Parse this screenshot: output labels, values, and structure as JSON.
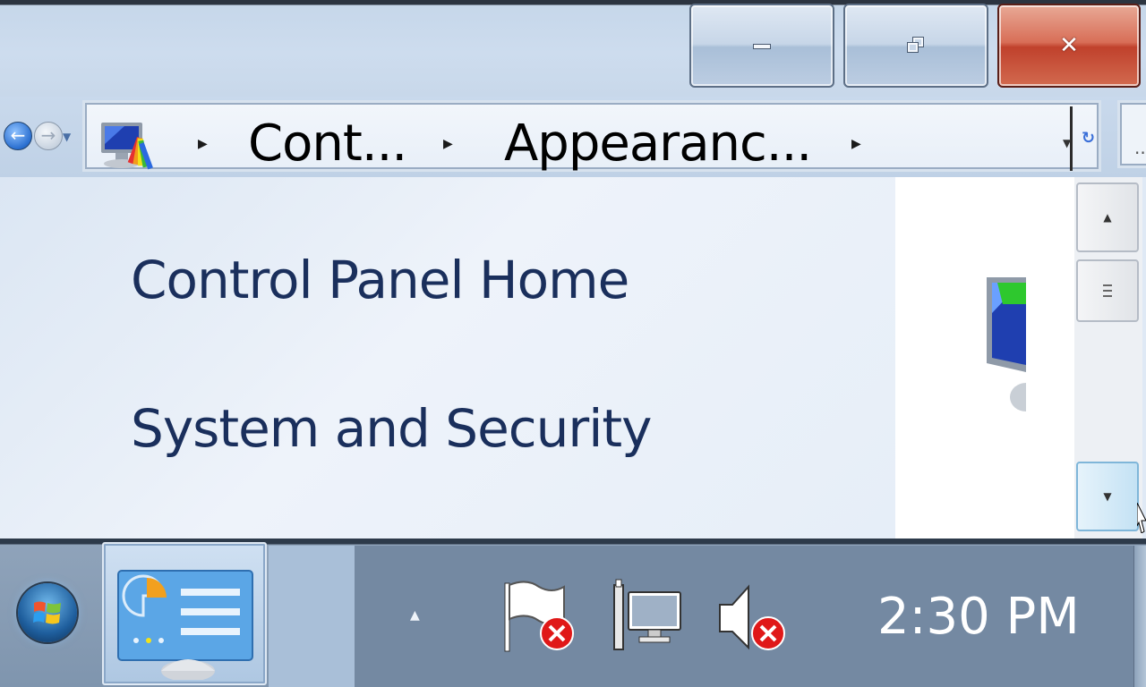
{
  "window": {
    "buttons": {
      "minimize": "minimize",
      "restore": "restore",
      "close": "close"
    }
  },
  "nav": {
    "back_icon": "back-arrow-icon",
    "forward_icon": "forward-arrow-icon",
    "breadcrumbs": [
      "Cont...",
      "Appearanc..."
    ],
    "address_icon": "control-panel-appearance-icon",
    "search_placeholder": ".."
  },
  "left_pane": {
    "links": [
      "Control Panel Home",
      "System and Security"
    ]
  },
  "taskbar": {
    "active_app_icon": "control-panel-icon",
    "tray_icons": [
      "action-center-flag-icon",
      "network-icon",
      "volume-muted-icon"
    ],
    "clock": "2:30 PM"
  },
  "colors": {
    "close_button": "#c0412c",
    "link_text": "#1a2f5c",
    "taskbar": "#7f95ae"
  }
}
